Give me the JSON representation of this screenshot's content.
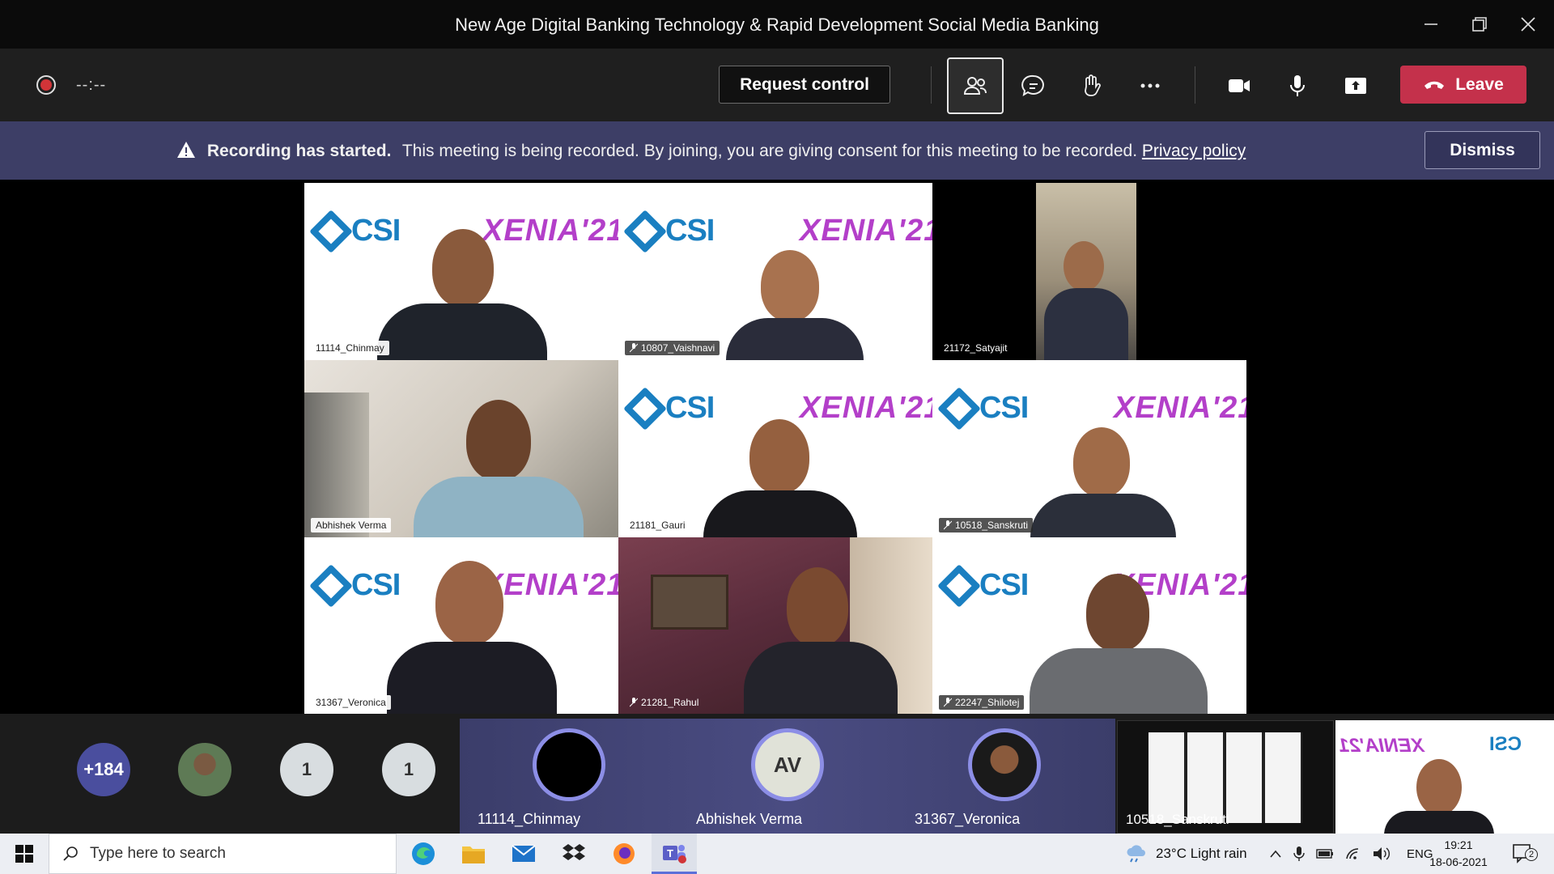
{
  "window": {
    "title": "New Age Digital Banking Technology & Rapid Development Social Media Banking"
  },
  "toolbar": {
    "timer": "--:--",
    "request_control_label": "Request control",
    "leave_label": "Leave",
    "icons": [
      "participants-icon",
      "chat-icon",
      "raise-hand-icon",
      "more-options-icon",
      "camera-icon",
      "microphone-icon",
      "share-screen-icon"
    ]
  },
  "banner": {
    "bold_text": "Recording has started.",
    "message": "This meeting is being recorded. By joining, you are giving consent for this meeting to be recorded.",
    "link": "Privacy policy",
    "dismiss_label": "Dismiss",
    "background": "#3d3e66"
  },
  "grid": {
    "csi_text": "CSI",
    "xenia_text": "XENIA'21",
    "tiles": [
      {
        "name": "11114_Chinmay",
        "muted": false
      },
      {
        "name": "10807_Vaishnavi",
        "muted": true
      },
      {
        "name": "21172_Satyajit",
        "muted": false
      },
      {
        "name": "Abhishek Verma",
        "muted": false
      },
      {
        "name": "21181_Gauri",
        "muted": false
      },
      {
        "name": "10518_Sanskruti",
        "muted": true
      },
      {
        "name": "31367_Veronica",
        "muted": false
      },
      {
        "name": "21281_Rahul",
        "muted": true
      },
      {
        "name": "22247_Shilotej",
        "muted": true
      }
    ]
  },
  "strip": {
    "overflow_count": "+184",
    "count_a": "1",
    "count_b": "1",
    "spotlights": [
      {
        "name": "11114_Chinmay",
        "initials": ""
      },
      {
        "name": "Abhishek Verma",
        "initials": "AV"
      },
      {
        "name": "31367_Veronica",
        "initials": ""
      }
    ],
    "screen_share_name": "10518_Sanskruti"
  },
  "taskbar": {
    "search_placeholder": "Type here to search",
    "weather": "23°C  Light rain",
    "language": "ENG",
    "time": "19:21",
    "date": "18-06-2021",
    "notification_count": "2"
  },
  "colors": {
    "leave": "#c4314b",
    "brand_blue": "#1a7fc1",
    "xenia_purple": "#b33fc9",
    "spotlight_ring": "#8c8ee6"
  }
}
